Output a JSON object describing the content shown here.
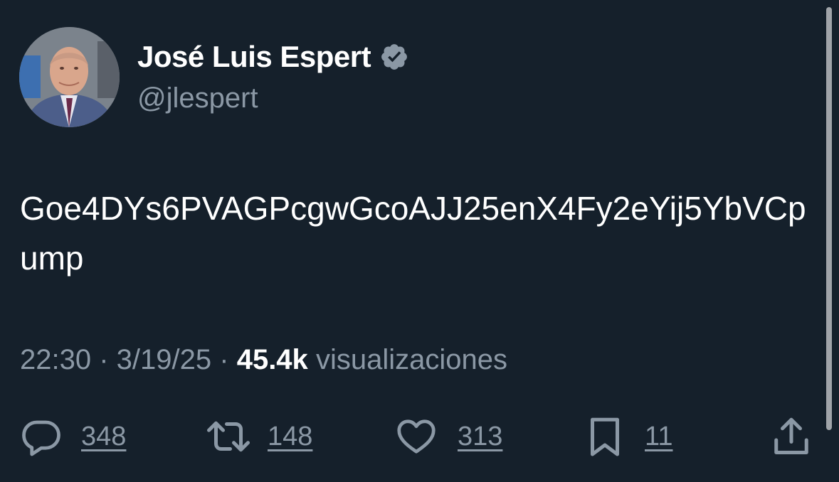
{
  "author": {
    "display_name": "José Luis Espert",
    "handle": "@jlespert",
    "verified_icon": "verified-badge-icon",
    "avatar_icon": "profile-photo"
  },
  "tweet": {
    "text": "Goe4DYs6PVAGPcgwGcoAJJ25enX4Fy2eYij5YbVCpump"
  },
  "meta": {
    "time": "22:30",
    "date": "3/19/25",
    "separator": "·",
    "views_count": "45.4k",
    "views_label": "visualizaciones"
  },
  "actions": {
    "reply": {
      "icon": "reply-icon",
      "count": "348"
    },
    "retweet": {
      "icon": "retweet-icon",
      "count": "148"
    },
    "like": {
      "icon": "heart-icon",
      "count": "313"
    },
    "bookmark": {
      "icon": "bookmark-icon",
      "count": "11"
    },
    "share": {
      "icon": "share-icon"
    }
  },
  "colors": {
    "background": "#15202b",
    "primary_text": "#ffffff",
    "secondary_text": "#8b98a5",
    "badge": "#8b98a5"
  }
}
